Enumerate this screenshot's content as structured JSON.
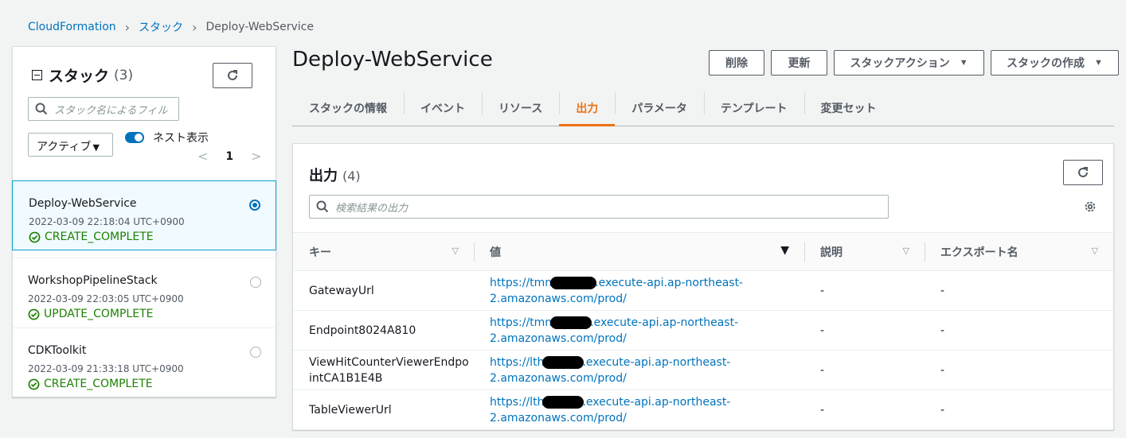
{
  "breadcrumb": {
    "root": "CloudFormation",
    "parent": "スタック",
    "current": "Deploy-WebService"
  },
  "left_panel": {
    "title": "スタック",
    "count": "(3)",
    "search_placeholder": "スタック名によるフィル",
    "filter_select": "アクティブ",
    "nested_toggle_label": "ネスト表示",
    "nested_toggle_on": true,
    "page": "1",
    "stacks": [
      {
        "name": "Deploy-WebService",
        "date": "2022-03-09 22:18:04 UTC+0900",
        "status": "CREATE_COMPLETE",
        "selected": true
      },
      {
        "name": "WorkshopPipelineStack",
        "date": "2022-03-09 22:03:05 UTC+0900",
        "status": "UPDATE_COMPLETE",
        "selected": false
      },
      {
        "name": "CDKToolkit",
        "date": "2022-03-09 21:33:18 UTC+0900",
        "status": "CREATE_COMPLETE",
        "selected": false
      }
    ]
  },
  "header": {
    "title": "Deploy-WebService",
    "buttons": {
      "delete": "削除",
      "update": "更新",
      "actions": "スタックアクション",
      "create": "スタックの作成"
    }
  },
  "tabs": [
    "スタックの情報",
    "イベント",
    "リソース",
    "出力",
    "パラメータ",
    "テンプレート",
    "変更セット"
  ],
  "active_tab": "出力",
  "outputs": {
    "title": "出力",
    "count": "(4)",
    "search_placeholder": "検索結果の出力",
    "columns": [
      "キー",
      "値",
      "説明",
      "エクスポート名"
    ],
    "rows": [
      {
        "key": "GatewayUrl",
        "value_prefix": "https://tmn",
        "value_suffix": ".execute-api.ap-northeast-",
        "value_line2": "2.amazonaws.com/prod/",
        "description": "-",
        "export": "-"
      },
      {
        "key": "Endpoint8024A810",
        "value_prefix": "https://tmn",
        "value_suffix": ".execute-api.ap-northeast-",
        "value_line2": "2.amazonaws.com/prod/",
        "description": "-",
        "export": "-"
      },
      {
        "key": "ViewHitCounterViewerEndpo",
        "key_line2": "intCA1B1E4B",
        "value_prefix": "https://lth",
        "value_suffix": ".execute-api.ap-northeast-",
        "value_line2": "2.amazonaws.com/prod/",
        "description": "-",
        "export": "-"
      },
      {
        "key": "TableViewerUrl",
        "value_prefix": "https://lth",
        "value_suffix": ".execute-api.ap-northeast-",
        "value_line2": "2.amazonaws.com/prod/",
        "description": "-",
        "export": "-"
      }
    ]
  },
  "colors": {
    "link": "#0073bb",
    "accent": "#ec7211",
    "success": "#1d8102"
  }
}
